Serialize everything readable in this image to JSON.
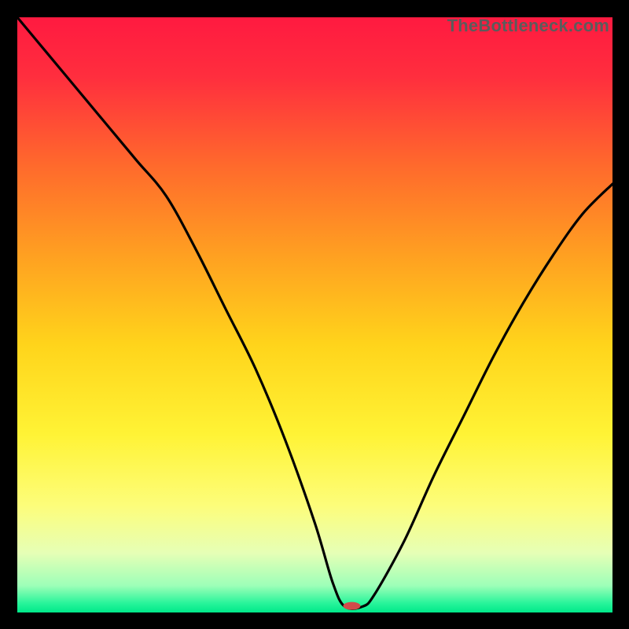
{
  "watermark": "TheBottleneck.com",
  "chart_data": {
    "type": "line",
    "title": "",
    "xlabel": "",
    "ylabel": "",
    "xlim": [
      0,
      100
    ],
    "ylim": [
      0,
      100
    ],
    "grid": false,
    "legend": false,
    "series": [
      {
        "name": "bottleneck-curve",
        "x": [
          0,
          5,
          10,
          15,
          20,
          25,
          30,
          35,
          40,
          45,
          50,
          53,
          55,
          58,
          60,
          65,
          70,
          75,
          80,
          85,
          90,
          95,
          100
        ],
        "y": [
          100,
          94,
          88,
          82,
          76,
          70,
          61,
          51,
          41,
          29,
          15,
          5,
          1,
          1,
          3,
          12,
          23,
          33,
          43,
          52,
          60,
          67,
          72
        ]
      }
    ],
    "marker": {
      "x": 56.2,
      "y": 1.1,
      "color": "#d24a4a",
      "rx": 11,
      "ry": 5
    },
    "background_gradient": {
      "stops": [
        {
          "offset": 0.0,
          "color": "#ff1a40"
        },
        {
          "offset": 0.1,
          "color": "#ff2e3e"
        },
        {
          "offset": 0.25,
          "color": "#ff6a2c"
        },
        {
          "offset": 0.4,
          "color": "#ffa021"
        },
        {
          "offset": 0.55,
          "color": "#ffd41b"
        },
        {
          "offset": 0.7,
          "color": "#fff335"
        },
        {
          "offset": 0.82,
          "color": "#fdfd7a"
        },
        {
          "offset": 0.9,
          "color": "#e6ffb6"
        },
        {
          "offset": 0.955,
          "color": "#9dffb8"
        },
        {
          "offset": 0.985,
          "color": "#26f49a"
        },
        {
          "offset": 1.0,
          "color": "#00e889"
        }
      ]
    }
  }
}
